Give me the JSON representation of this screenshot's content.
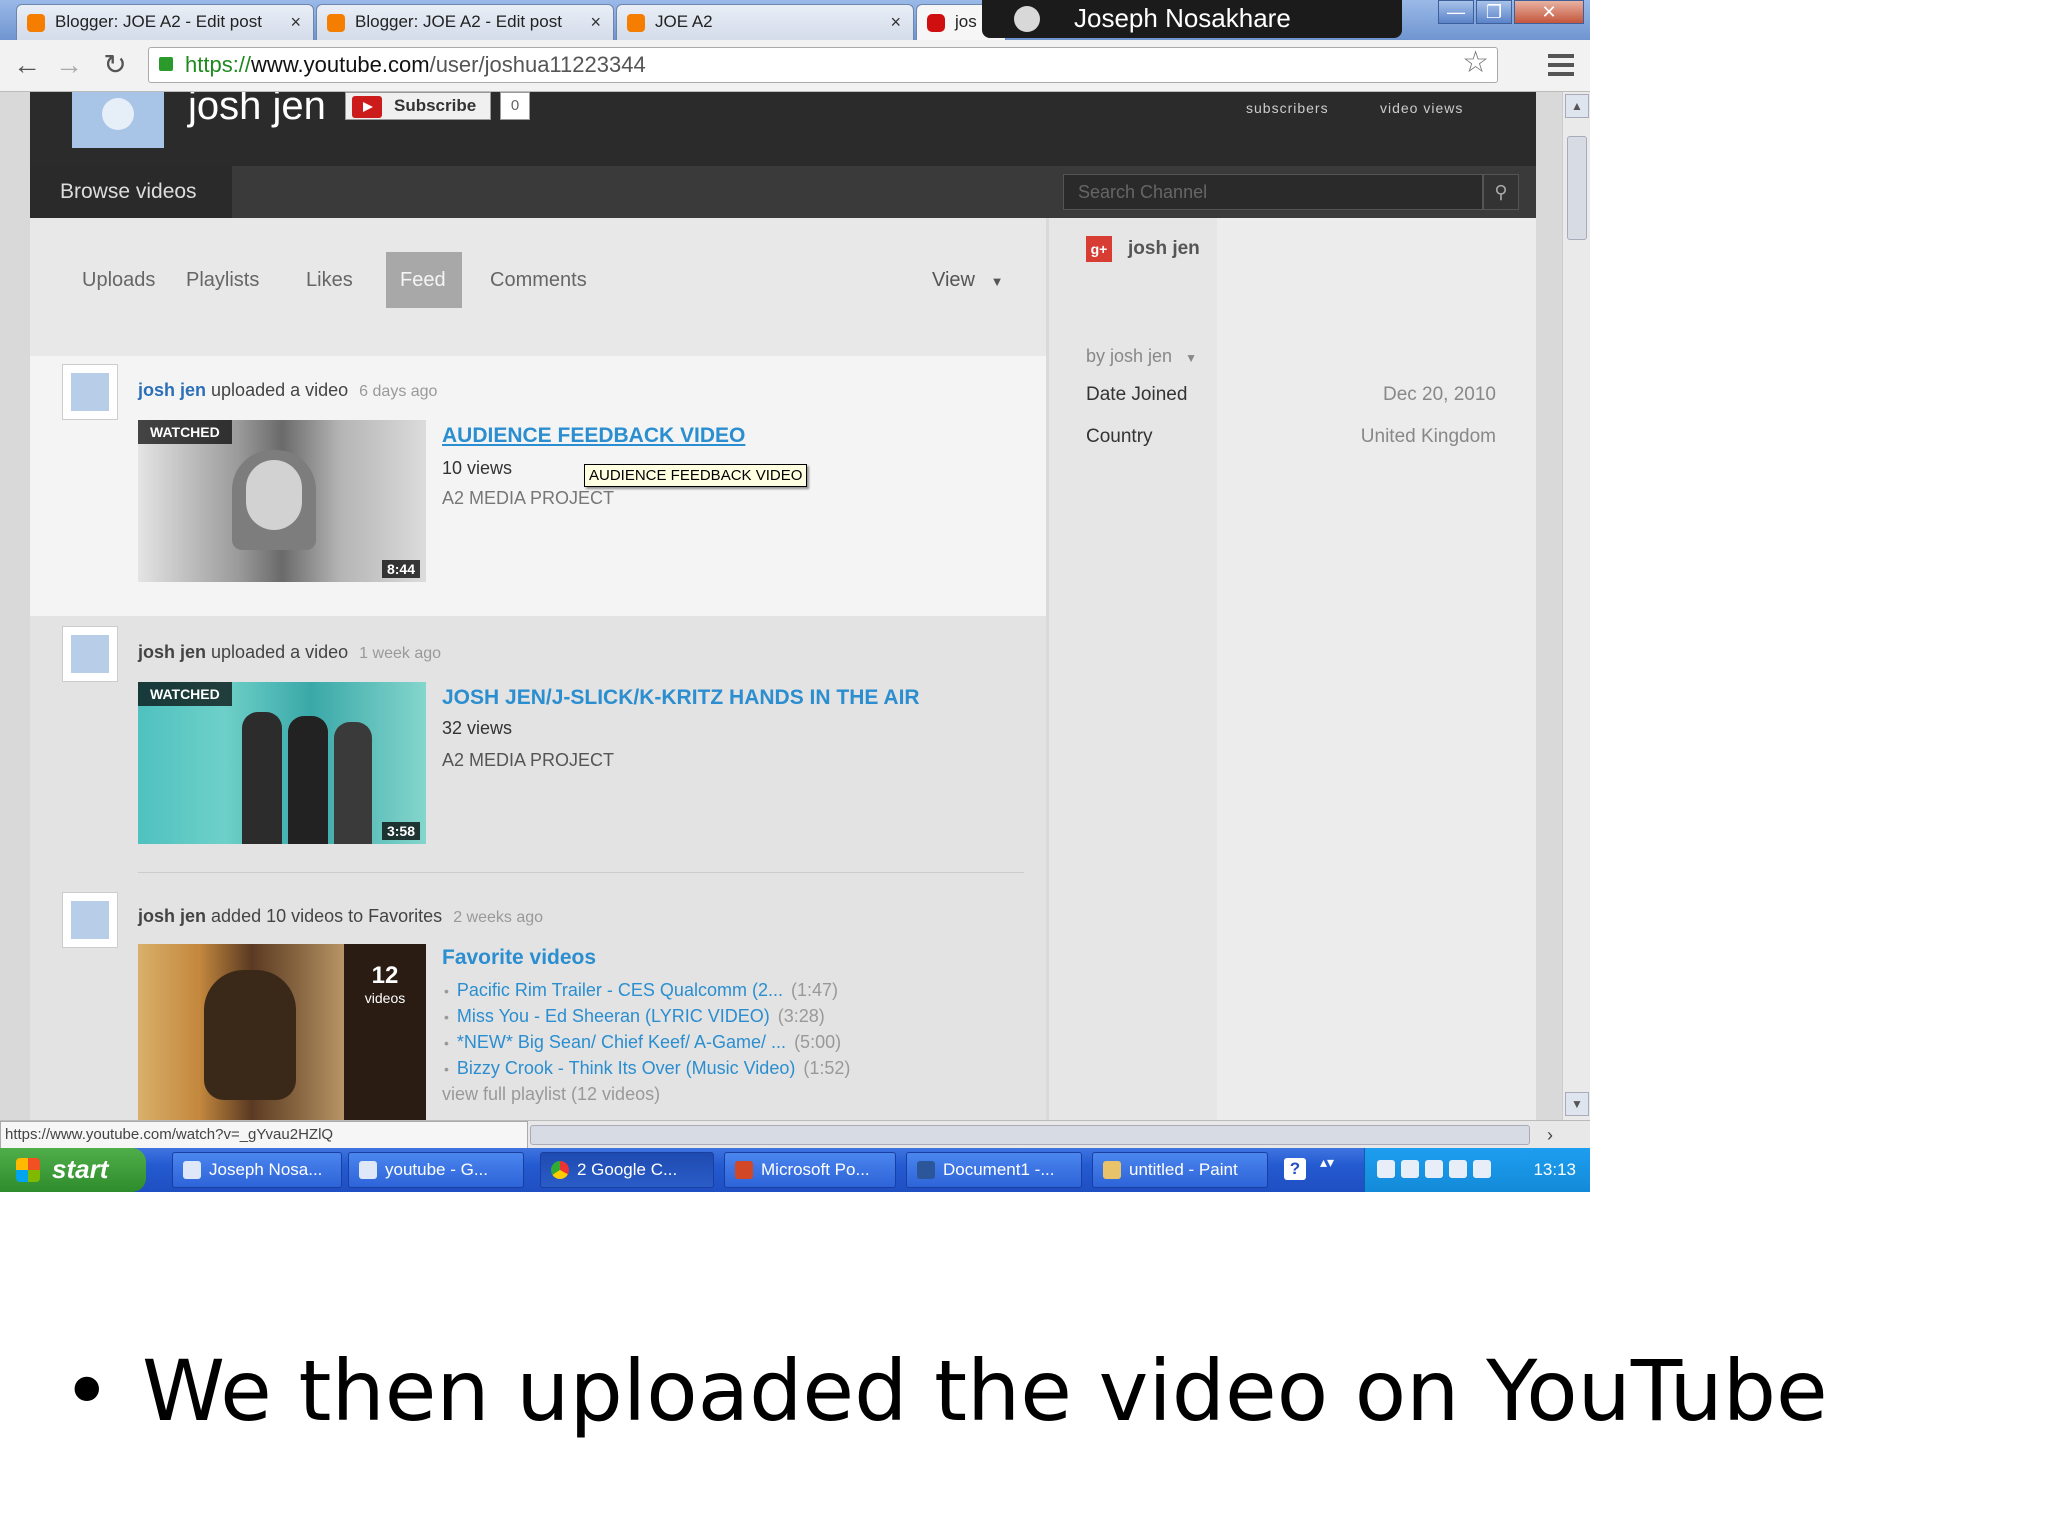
{
  "browser": {
    "tabs": [
      {
        "title": "Blogger: JOE A2 - Edit post",
        "icon": "blogger-icon"
      },
      {
        "title": "Blogger: JOE A2 - Edit post",
        "icon": "blogger-icon"
      },
      {
        "title": "JOE A2",
        "icon": "blogger-icon"
      },
      {
        "title": "jos",
        "icon": "youtube-icon"
      }
    ],
    "close_glyph": "×",
    "profile_name": "Joseph Nosakhare",
    "window_buttons": [
      "—",
      "❐",
      "✕"
    ],
    "url_scheme": "https://",
    "url_host": "www.youtube.com",
    "url_path": "/user/joshua11223344",
    "status_url": "https://www.youtube.com/watch?v=_gYvau2HZlQ"
  },
  "channel": {
    "name": "josh jen",
    "subscribe_label": "Subscribe",
    "subscriber_count_badge": "0",
    "stats": [
      {
        "label": "subscribers"
      },
      {
        "label": "video views"
      }
    ],
    "browse_label": "Browse videos",
    "search_placeholder": "Search Channel"
  },
  "tabs": {
    "items": [
      "Uploads",
      "Playlists",
      "Likes",
      "Feed",
      "Comments"
    ],
    "active": "Feed",
    "view_label": "View"
  },
  "feed": [
    {
      "user": "josh jen",
      "action": "uploaded a video",
      "ago": "6 days ago",
      "watched_label": "WATCHED",
      "duration": "8:44",
      "title": "AUDIENCE FEEDBACK VIDEO",
      "views": "10 views",
      "owner": "A2 MEDIA PROJECT",
      "tooltip": "AUDIENCE FEEDBACK VIDEO"
    },
    {
      "user": "josh jen",
      "action": "uploaded a video",
      "ago": "1 week ago",
      "watched_label": "WATCHED",
      "duration": "3:58",
      "title": "JOSH JEN/J-SLICK/K-KRITZ HANDS IN THE AIR",
      "views": "32 views",
      "owner": "A2 MEDIA PROJECT"
    },
    {
      "user": "josh jen",
      "action": "added 10 videos to Favorites",
      "ago": "2 weeks ago",
      "playlist_count": "12",
      "playlist_count_label": "videos",
      "title": "Favorite videos",
      "items": [
        {
          "title": "Pacific Rim Trailer - CES Qualcomm (2...",
          "duration": "(1:47)"
        },
        {
          "title": "Miss You - Ed Sheeran (LYRIC VIDEO)",
          "duration": "(3:28)"
        },
        {
          "title": "*NEW* Big Sean/ Chief Keef/ A-Game/ ...",
          "duration": "(5:00)"
        },
        {
          "title": "Bizzy Crook - Think Its Over (Music Video)",
          "duration": "(1:52)"
        }
      ],
      "view_full": "view full playlist (12 videos)"
    }
  ],
  "sidebar": {
    "gplus_label": "g+",
    "name": "josh jen",
    "by_label": "by josh jen",
    "date_joined_label": "Date Joined",
    "date_joined": "Dec 20, 2010",
    "country_label": "Country",
    "country": "United Kingdom"
  },
  "taskbar": {
    "start_label": "start",
    "tasks": [
      "Joseph Nosa...",
      "youtube - G...",
      "2 Google C...",
      "Microsoft Po...",
      "Document1 -...",
      "untitled - Paint"
    ],
    "clock": "13:13"
  },
  "slide": {
    "bullet": "•",
    "caption": "We then uploaded the video on YouTube"
  }
}
